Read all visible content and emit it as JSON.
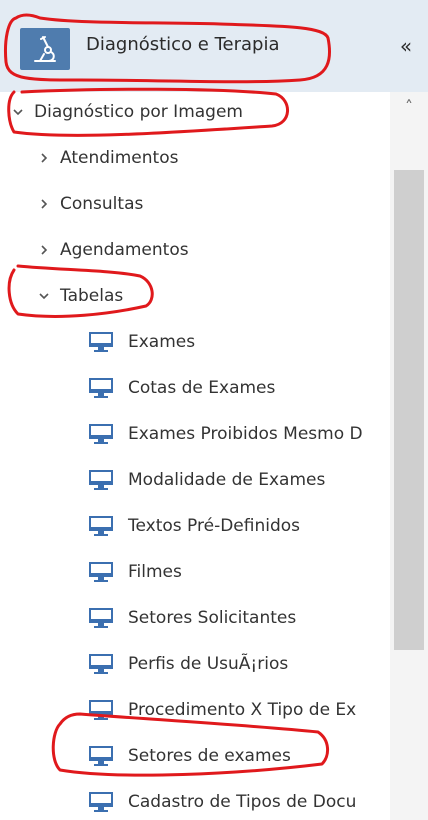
{
  "header": {
    "title": "Diagnóstico e Terapia",
    "icon": "microscope-icon",
    "collapse_icon": "double-chevron-left-icon",
    "collapse_glyph": "«"
  },
  "tree": {
    "root": {
      "label": "Diagnóstico por Imagem",
      "expanded": true
    },
    "groups": [
      {
        "label": "Atendimentos",
        "expanded": false
      },
      {
        "label": "Consultas",
        "expanded": false
      },
      {
        "label": "Agendamentos",
        "expanded": false
      },
      {
        "label": "Tabelas",
        "expanded": true
      }
    ],
    "tabelas_items": [
      {
        "label": "Exames"
      },
      {
        "label": "Cotas de Exames"
      },
      {
        "label": "Exames Proibidos Mesmo D"
      },
      {
        "label": "Modalidade de Exames"
      },
      {
        "label": "Textos Pré-Definidos"
      },
      {
        "label": "Filmes"
      },
      {
        "label": "Setores Solicitantes"
      },
      {
        "label": "Perfis de UsuÃ¡rios"
      },
      {
        "label": "Procedimento X Tipo de Ex"
      },
      {
        "label": "Setores de exames"
      },
      {
        "label": "Cadastro de Tipos de Docu"
      }
    ]
  },
  "colors": {
    "header_bg": "#e3ebf3",
    "badge_bg": "#4f7cae",
    "monitor_icon": "#3b6fb0",
    "annotation": "#e0191c"
  },
  "scrollbar": {
    "up_glyph": "˄"
  }
}
